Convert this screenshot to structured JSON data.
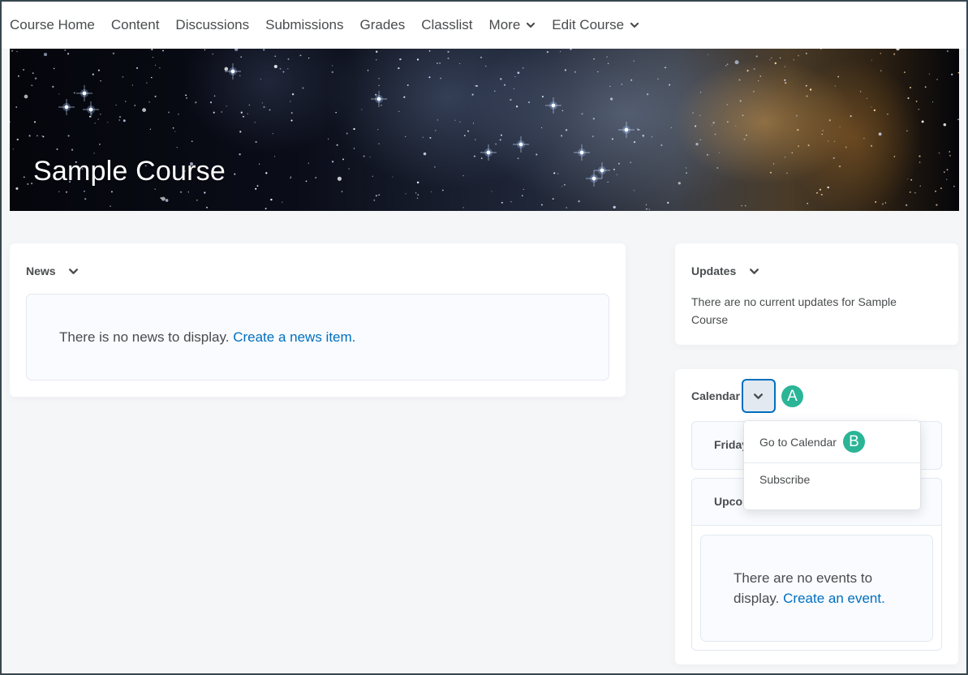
{
  "nav": {
    "items": [
      {
        "label": "Course Home",
        "has_dropdown": false
      },
      {
        "label": "Content",
        "has_dropdown": false
      },
      {
        "label": "Discussions",
        "has_dropdown": false
      },
      {
        "label": "Submissions",
        "has_dropdown": false
      },
      {
        "label": "Grades",
        "has_dropdown": false
      },
      {
        "label": "Classlist",
        "has_dropdown": false
      },
      {
        "label": "More",
        "has_dropdown": true
      },
      {
        "label": "Edit Course",
        "has_dropdown": true
      }
    ]
  },
  "banner": {
    "title": "Sample Course"
  },
  "news": {
    "title": "News",
    "empty_text": "There is no news to display.",
    "create_link": "Create a news item."
  },
  "updates": {
    "title": "Updates",
    "text": "There are no current updates for Sample Course"
  },
  "calendar": {
    "title": "Calendar",
    "friday_label": "Friday",
    "upcoming_label": "Upcoming",
    "empty_text": "There are no events to display.",
    "create_link": "Create an event."
  },
  "dropdown": {
    "items": [
      {
        "label": "Go to Calendar"
      },
      {
        "label": "Subscribe"
      }
    ]
  },
  "annotations": {
    "a": "A",
    "b": "B"
  },
  "colors": {
    "link": "#006fbf",
    "focus_ring": "#006fbf",
    "badge": "#2bb597",
    "text": "#494c4e",
    "page_bg": "#f5f6f8",
    "frame_border": "#37474f"
  }
}
